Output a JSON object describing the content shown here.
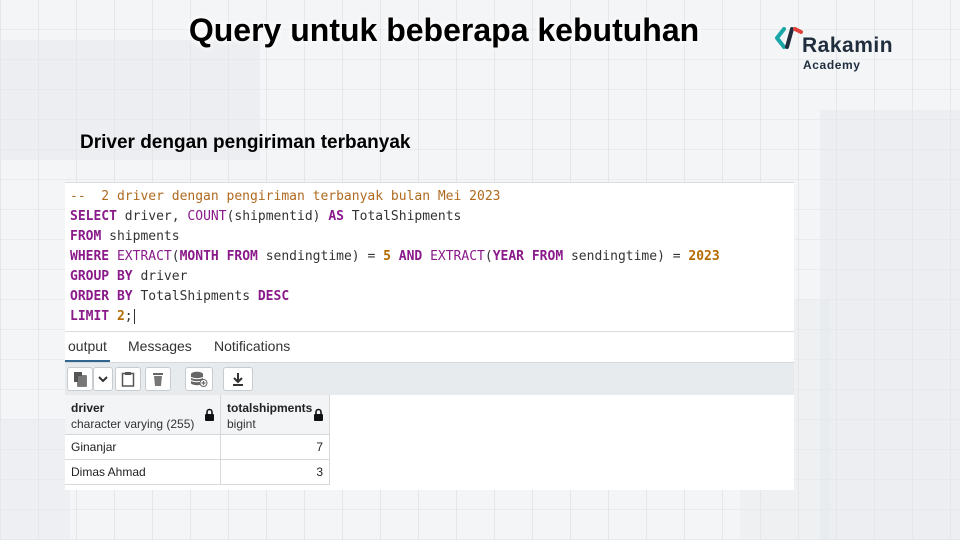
{
  "slide": {
    "title": "Query untuk beberapa kebutuhan",
    "subtitle": "Driver dengan pengiriman terbanyak"
  },
  "logo": {
    "name": "Rakamin",
    "sub": "Academy",
    "mark_color": "#1aa6a6"
  },
  "editor": {
    "comment": "--  2 driver dengan pengiriman terbanyak bulan Mei 2023",
    "line2": {
      "k1": "SELECT",
      "t1": " driver, ",
      "f1": "COUNT",
      "t2": "(shipmentid) ",
      "k2": "AS",
      "t3": " TotalShipments"
    },
    "line3": {
      "k1": "FROM",
      "t1": " shipments"
    },
    "line4": {
      "k1": "WHERE",
      "t1": " ",
      "f1": "EXTRACT",
      "t2": "(",
      "k2": "MONTH",
      "t3": " ",
      "k3": "FROM",
      "t4": " sendingtime) = ",
      "n1": "5",
      "t5": " ",
      "k4": "AND",
      "t6": " ",
      "f2": "EXTRACT",
      "t7": "(",
      "k5": "YEAR",
      "t8": " ",
      "k6": "FROM",
      "t9": " sendingtime) = ",
      "n2": "2023"
    },
    "line5": {
      "k1": "GROUP BY",
      "t1": " driver"
    },
    "line6": {
      "k1": "ORDER BY",
      "t1": " TotalShipments ",
      "k2": "DESC"
    },
    "line7": {
      "k1": "LIMIT",
      "t1": " ",
      "n1": "2",
      "t2": ";"
    }
  },
  "tabs": [
    {
      "label": "output"
    },
    {
      "label": "Messages"
    },
    {
      "label": "Notifications"
    }
  ],
  "toolbar": {
    "icons": [
      "copy-icon",
      "chevron-down-icon",
      "clipboard-icon",
      "trash-icon",
      "database-add-icon",
      "download-icon"
    ]
  },
  "table": {
    "columns": [
      {
        "name": "driver",
        "type": "character varying (255)"
      },
      {
        "name": "totalshipments",
        "type": "bigint"
      }
    ],
    "rows": [
      {
        "driver": "Ginanjar",
        "totalshipments": "7"
      },
      {
        "driver": "Dimas Ahmad",
        "totalshipments": "3"
      }
    ]
  },
  "colors": {
    "accent": "#326690",
    "keyword": "#8a1a8a",
    "number": "#b46a00",
    "comment": "#b06a20"
  }
}
